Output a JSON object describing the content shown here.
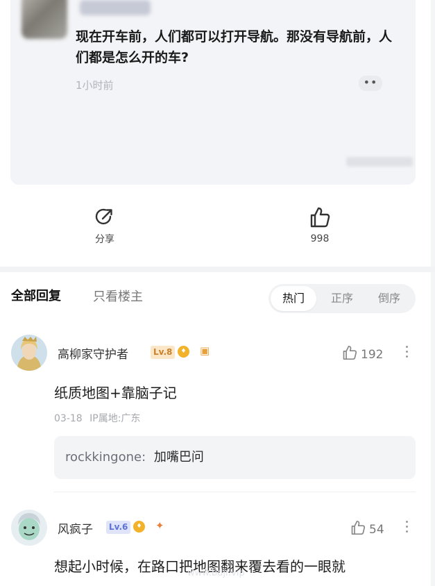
{
  "post": {
    "title": "现在开车前，人们都可以打开导航。那没有导航前，人们都是怎么开的车?",
    "time": "1小时前",
    "more": "••"
  },
  "actions": {
    "share_label": "分享",
    "like_count": "998"
  },
  "tabs": {
    "all_replies": "全部回复",
    "op_only": "只看楼主",
    "sort_hot": "热门",
    "sort_asc": "正序",
    "sort_desc": "倒序"
  },
  "comments": [
    {
      "username": "高柳家守护者",
      "level": "Lv.8",
      "likes": "192",
      "text": "纸质地图+靠脑子记",
      "date": "03-18",
      "ip": "IP属地:广东",
      "reply": {
        "user": "rockkingone:",
        "text": "加嘴巴问"
      }
    },
    {
      "username": "风疯子",
      "level": "Lv.6",
      "likes": "54",
      "text": "想起小时候，在路口把地图翻来覆去看的一眼就"
    }
  ],
  "watermark": "www.bdjr.vip",
  "colors": {
    "lv8_bg": "#fbe6c8",
    "lv8_fg": "#c9822a",
    "lv6_bg": "#dfe4fb",
    "lv6_fg": "#5d72d6",
    "badge": "#f2b32b"
  }
}
